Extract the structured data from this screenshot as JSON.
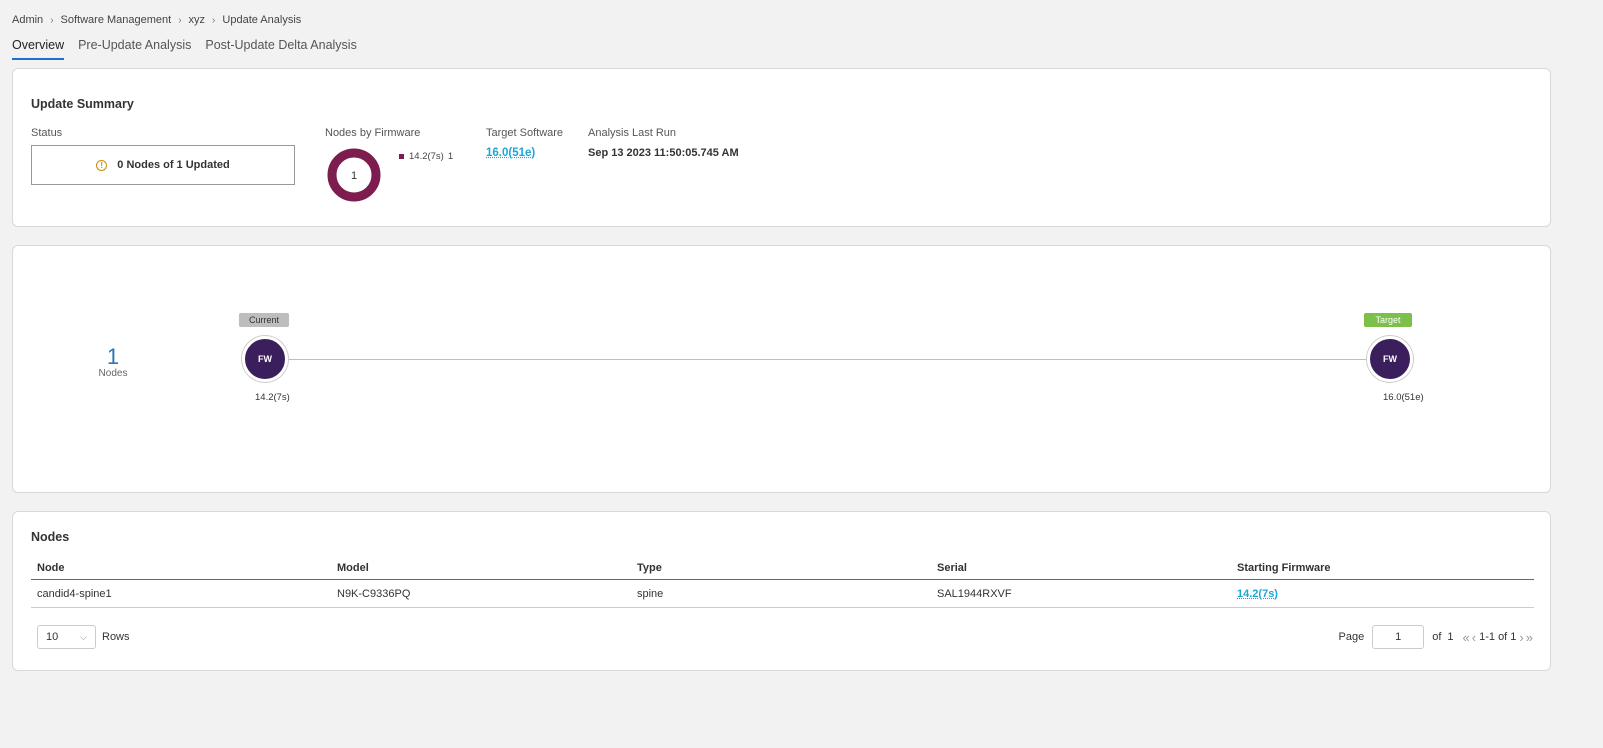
{
  "breadcrumb": [
    "Admin",
    "Software Management",
    "xyz",
    "Update Analysis"
  ],
  "tabs": [
    {
      "label": "Overview",
      "active": true
    },
    {
      "label": "Pre-Update Analysis",
      "active": false
    },
    {
      "label": "Post-Update Delta Analysis",
      "active": false
    }
  ],
  "summary": {
    "title": "Update Summary",
    "status_label": "Status",
    "status_text": "0 Nodes of 1 Updated",
    "nodes_by_fw_label": "Nodes by Firmware",
    "donut_center": "1",
    "donut_color": "#7d1d4f",
    "legend": [
      {
        "name": "14.2(7s)",
        "count": "1"
      }
    ],
    "target_label": "Target Software",
    "target_value": "16.0(51e)",
    "last_run_label": "Analysis Last Run",
    "last_run_value": "Sep 13 2023 11:50:05.745 AM"
  },
  "diagram": {
    "count": "1",
    "count_label": "Nodes",
    "current_tag": "Current",
    "target_tag": "Target",
    "current_fw_icon": "FW",
    "target_fw_icon": "FW",
    "current_version": "14.2(7s)",
    "target_version": "16.0(51e)"
  },
  "nodes": {
    "title": "Nodes",
    "columns": [
      "Node",
      "Model",
      "Type",
      "Serial",
      "Starting Firmware"
    ],
    "rows": [
      [
        "candid4-spine1",
        "N9K-C9336PQ",
        "spine",
        "SAL1944RXVF",
        "14.2(7s)"
      ]
    ],
    "rows_per_page": "10",
    "rows_label": "Rows",
    "page_label": "Page",
    "page_value": "1",
    "of_label": "of",
    "total_pages": "1",
    "range": "1-1 of 1"
  }
}
